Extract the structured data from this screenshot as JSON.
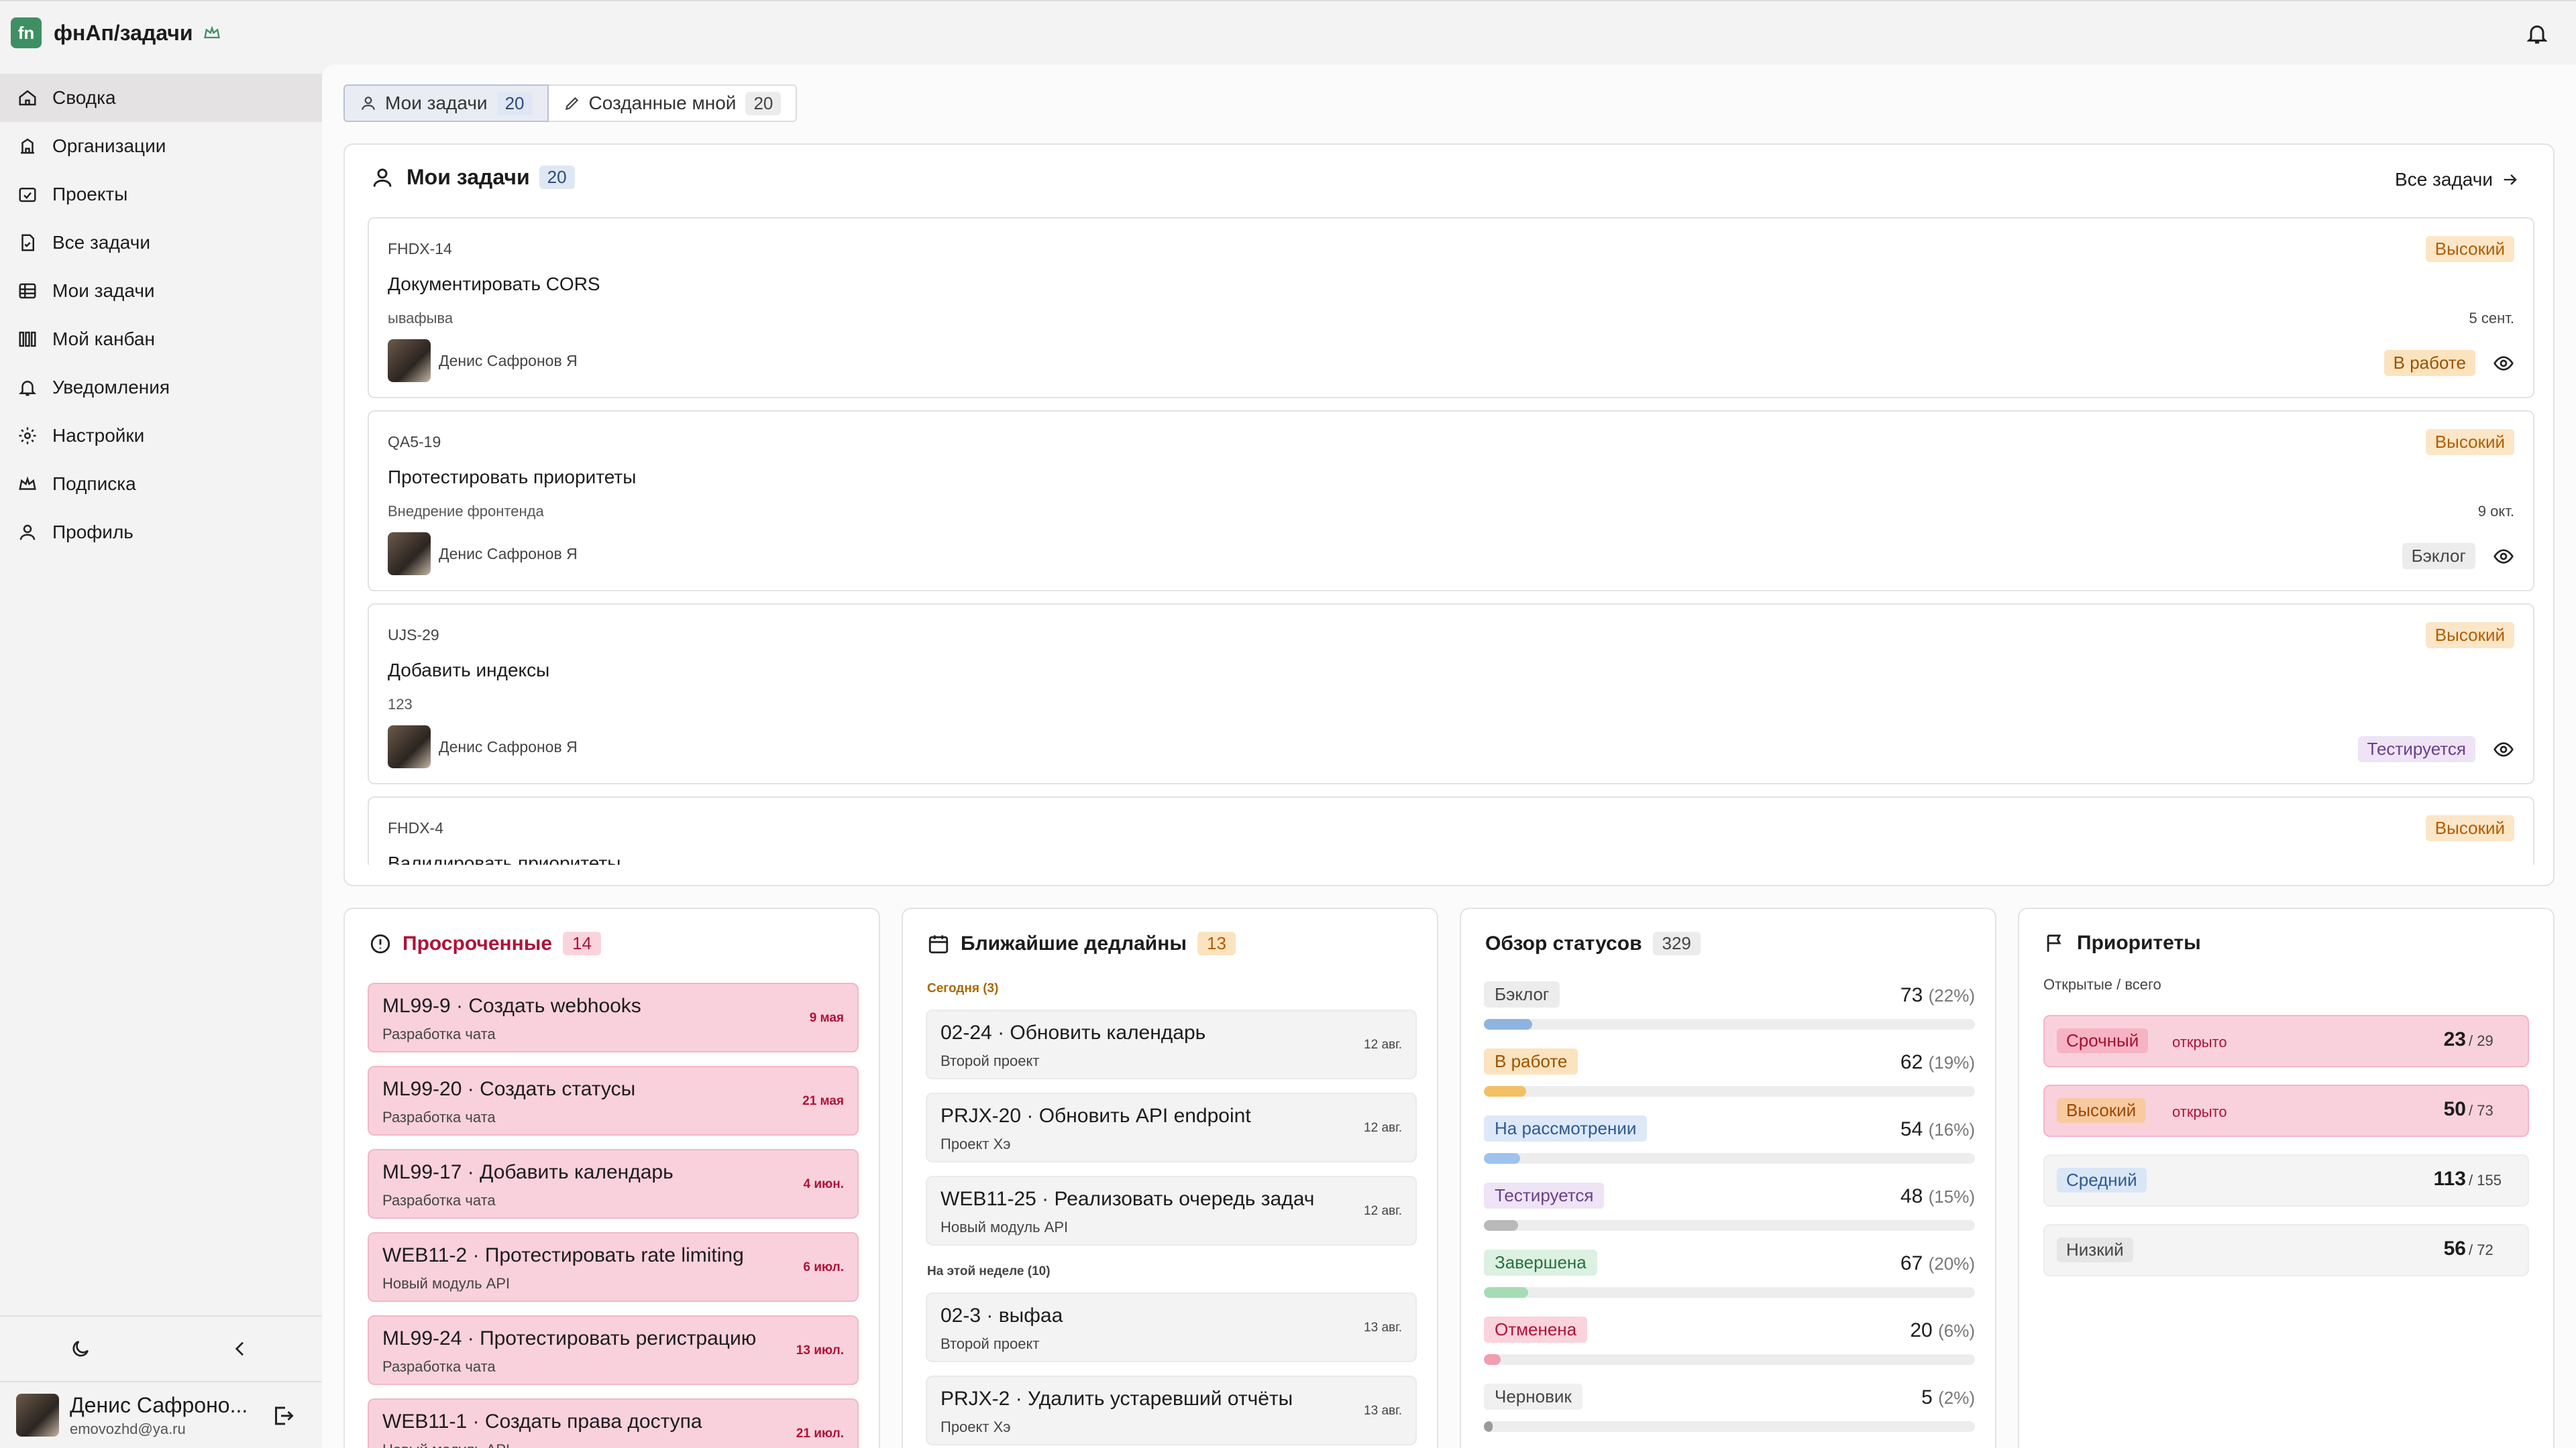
{
  "app": {
    "title": "фнАп/задачи",
    "logo_text": "fn"
  },
  "sidebar": {
    "items": [
      {
        "label": "Сводка",
        "icon": "home-icon",
        "active": true
      },
      {
        "label": "Организации",
        "icon": "building-icon"
      },
      {
        "label": "Проекты",
        "icon": "projects-icon"
      },
      {
        "label": "Все задачи",
        "icon": "file-check-icon"
      },
      {
        "label": "Мои задачи",
        "icon": "table-icon"
      },
      {
        "label": "Мой канбан",
        "icon": "kanban-icon"
      },
      {
        "label": "Уведомления",
        "icon": "bell-icon"
      },
      {
        "label": "Настройки",
        "icon": "gear-icon"
      },
      {
        "label": "Подписка",
        "icon": "crown-icon"
      },
      {
        "label": "Профиль",
        "icon": "user-icon"
      }
    ],
    "user": {
      "name": "Денис Сафроно...",
      "email": "emovozhd@ya.ru"
    }
  },
  "tabs": [
    {
      "label": "Мои задачи",
      "count": "20"
    },
    {
      "label": "Созданные мной",
      "count": "20"
    }
  ],
  "my_tasks": {
    "title": "Мои задачи",
    "count": "20",
    "all_link": "Все задачи",
    "tasks": [
      {
        "key": "FHDX-14",
        "title": "Документировать CORS",
        "desc": "ывафыва",
        "date": "5 сент.",
        "assignee": "Денис Сафронов Я",
        "priority": "Высокий",
        "status": "В работе"
      },
      {
        "key": "QA5-19",
        "title": "Протестировать приоритеты",
        "desc": "Внедрение фронтенда",
        "date": "9 окт.",
        "assignee": "Денис Сафронов Я",
        "priority": "Высокий",
        "status": "Бэклог"
      },
      {
        "key": "UJS-29",
        "title": "Добавить индексы",
        "desc": "123",
        "date": "",
        "assignee": "Денис Сафронов Я",
        "priority": "Высокий",
        "status": "Тестируется"
      },
      {
        "key": "FHDX-4",
        "title": "Валидировать приоритеты",
        "desc": "",
        "date": "",
        "assignee": "",
        "priority": "Высокий",
        "status": ""
      }
    ]
  },
  "overdue": {
    "title": "Просроченные",
    "count": "14",
    "items": [
      {
        "title": "ML99-9 · Создать webhooks",
        "project": "Разработка чата",
        "date": "9 мая"
      },
      {
        "title": "ML99-20 · Создать статусы",
        "project": "Разработка чата",
        "date": "21 мая"
      },
      {
        "title": "ML99-17 · Добавить календарь",
        "project": "Разработка чата",
        "date": "4 июн."
      },
      {
        "title": "WEB11-2 · Протестировать rate limiting",
        "project": "Новый модуль API",
        "date": "6 июл."
      },
      {
        "title": "ML99-24 · Протестировать регистрацию",
        "project": "Разработка чата",
        "date": "13 июл."
      },
      {
        "title": "WEB11-1 · Создать права доступа",
        "project": "Новый модуль API",
        "date": "21 июл."
      }
    ]
  },
  "deadlines": {
    "title": "Ближайшие дедлайны",
    "count": "13",
    "group_today": "Сегодня (3)",
    "group_week": "На этой неделе (10)",
    "today": [
      {
        "title": "02-24 · Обновить календарь",
        "project": "Второй проект",
        "date": "12 авг."
      },
      {
        "title": "PRJX-20 · Обновить API endpoint",
        "project": "Проект Хэ",
        "date": "12 авг."
      },
      {
        "title": "WEB11-25 · Реализовать очередь задач",
        "project": "Новый модуль API",
        "date": "12 авг."
      }
    ],
    "week": [
      {
        "title": "02-3 · выфаа",
        "project": "Второй проект",
        "date": "13 авг."
      },
      {
        "title": "PRJX-2 · Удалить устаревший отчёты",
        "project": "Проект Хэ",
        "date": "13 авг."
      }
    ]
  },
  "statuses": {
    "title": "Обзор статусов",
    "count": "329",
    "rows": [
      {
        "label": "Бэклог",
        "value": "73",
        "pct": "(22%)",
        "fraction": 0.22,
        "color": "#8fb3e0",
        "bg": "#ececec",
        "fg": "#444444"
      },
      {
        "label": "В работе",
        "value": "62",
        "pct": "(19%)",
        "fraction": 0.19,
        "color": "#f2c067",
        "bg": "#fbe3bf",
        "fg": "#9a5200"
      },
      {
        "label": "На рассмотрении",
        "value": "54",
        "pct": "(16%)",
        "fraction": 0.16,
        "color": "#9ec2ec",
        "bg": "#dde9f8",
        "fg": "#2f5a92"
      },
      {
        "label": "Тестируется",
        "value": "48",
        "pct": "(15%)",
        "fraction": 0.15,
        "color": "#b9b9b9",
        "bg": "#eee4f6",
        "fg": "#6a3f8c"
      },
      {
        "label": "Завершена",
        "value": "67",
        "pct": "(20%)",
        "fraction": 0.2,
        "color": "#a5dcb6",
        "bg": "#dcf1e2",
        "fg": "#2c6e42"
      },
      {
        "label": "Отменена",
        "value": "20",
        "pct": "(6%)",
        "fraction": 0.06,
        "color": "#f29db0",
        "bg": "#fbd3dc",
        "fg": "#b01238"
      },
      {
        "label": "Черновик",
        "value": "5",
        "pct": "(2%)",
        "fraction": 0.02,
        "color": "#9a9a9a",
        "bg": "#f0f0f0",
        "fg": "#444444"
      }
    ]
  },
  "priorities": {
    "title": "Приоритеты",
    "subtitle": "Открытые / всего",
    "rows": [
      {
        "label": "Срочный",
        "open_label": "открыто",
        "open": "23",
        "total": "/ 29",
        "hot": true,
        "bg": "#f7b3c3",
        "fg": "#a3102f"
      },
      {
        "label": "Высокий",
        "open_label": "открыто",
        "open": "50",
        "total": "/ 73",
        "hot": true,
        "bg": "#f9c9a0",
        "fg": "#9a4a00"
      },
      {
        "label": "Средний",
        "open_label": "",
        "open": "113",
        "total": "/ 155",
        "hot": false,
        "bg": "#d9e6f6",
        "fg": "#2f5a92"
      },
      {
        "label": "Низкий",
        "open_label": "",
        "open": "56",
        "total": "/ 72",
        "hot": false,
        "bg": "#e6e6e6",
        "fg": "#444444"
      }
    ]
  },
  "colors": {
    "accent": "#3f8f64",
    "overdue": "#b01238",
    "high": "#b25d00"
  }
}
